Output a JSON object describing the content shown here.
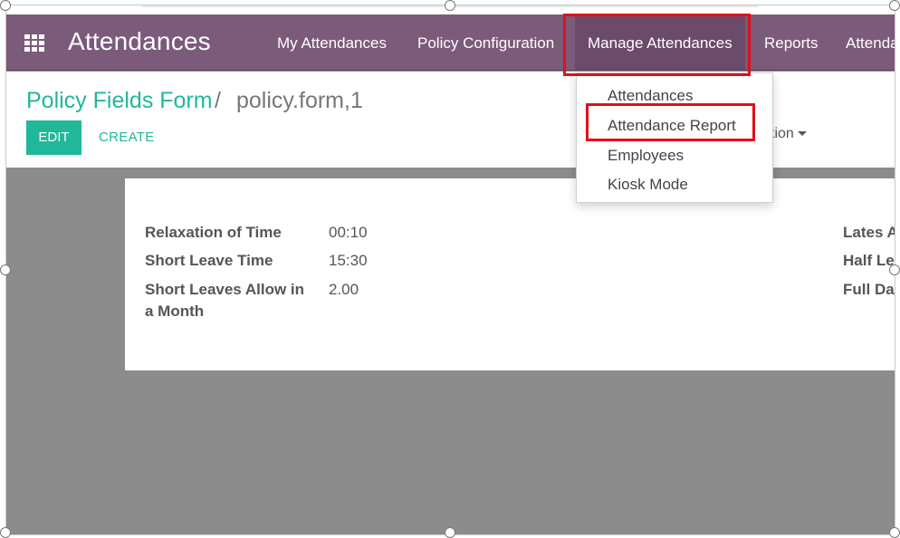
{
  "app": {
    "title": "Attendances",
    "apps_icon": "grid-icon"
  },
  "menu": [
    {
      "label": "My Attendances"
    },
    {
      "label": "Policy Configuration"
    },
    {
      "label": "Manage Attendances"
    },
    {
      "label": "Reports"
    },
    {
      "label": "Attenda"
    }
  ],
  "breadcrumb": {
    "parent": "Policy Fields Form",
    "separator": "/",
    "current": "policy.form,1"
  },
  "buttons": {
    "edit": "EDIT",
    "create": "CREATE",
    "action": "ction"
  },
  "dropdown": {
    "items": [
      {
        "label": "Attendances"
      },
      {
        "label": "Attendance Report"
      },
      {
        "label": "Employees"
      },
      {
        "label": "Kiosk Mode"
      }
    ]
  },
  "form": {
    "left_fields": [
      {
        "label": "Relaxation of Time",
        "value": "00:10"
      },
      {
        "label": "Short Leave Time",
        "value": "15:30"
      },
      {
        "label": "Short Leaves Allow in a Month",
        "value": "2.00"
      }
    ],
    "right_fields": [
      {
        "label": "Lates A"
      },
      {
        "label": "Half Le"
      },
      {
        "label": "Full Day"
      }
    ]
  },
  "colors": {
    "navbar": "#7c5a7a",
    "accent": "#21b799",
    "highlight": "#e0101a",
    "background": "#8c8c8c"
  }
}
